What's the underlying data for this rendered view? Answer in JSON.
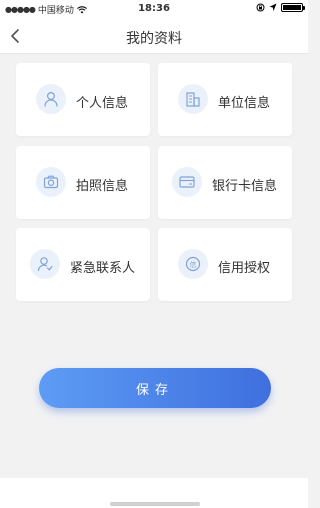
{
  "status_bar": {
    "signal": "●●●●●",
    "carrier": "中国移动",
    "time": "18:36"
  },
  "nav": {
    "title": "我的资料",
    "back_icon": "chevron-left-icon"
  },
  "cards": [
    {
      "label": "个人信息",
      "icon": "person-icon"
    },
    {
      "label": "单位信息",
      "icon": "building-icon"
    },
    {
      "label": "拍照信息",
      "icon": "camera-icon"
    },
    {
      "label": "银行卡信息",
      "icon": "bank-card-icon"
    },
    {
      "label": "紧急联系人",
      "icon": "contact-icon"
    },
    {
      "label": "信用授权",
      "icon": "credit-icon"
    }
  ],
  "credit_icon_text": "信",
  "save_label": "保存",
  "colors": {
    "accent_start": "#5d9cf5",
    "accent_end": "#3f6fde",
    "icon_stroke": "#7fa3d6",
    "background": "#f2f2f2"
  }
}
